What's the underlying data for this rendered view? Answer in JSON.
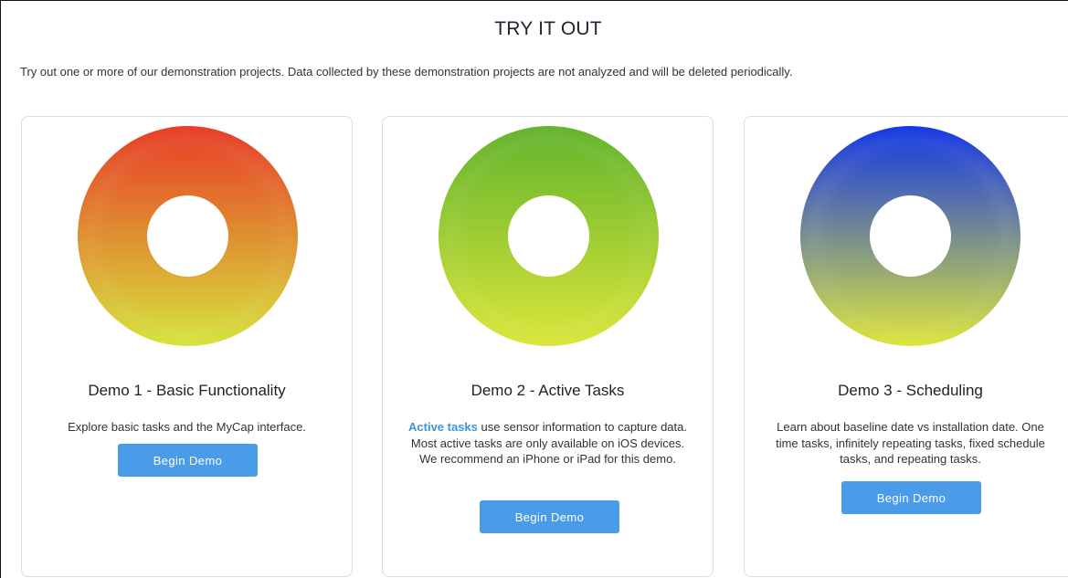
{
  "page": {
    "title": "TRY IT OUT",
    "intro": "Try out one or more of our demonstration projects. Data collected by these demonstration projects are not analyzed and will be deleted periodically."
  },
  "demos": [
    {
      "title": "Demo 1 - Basic Functionality",
      "description": "Explore basic tasks and the MyCap interface.",
      "button_label": "Begin Demo",
      "ring_colors": {
        "top": "#e83b26",
        "bottom": "#d6e33c"
      }
    },
    {
      "title": "Demo 2 - Active Tasks",
      "link_text": "Active tasks",
      "description": " use sensor information to capture data. Most active tasks are only available on iOS devices. We recommend an iPhone or iPad for this demo.",
      "button_label": "Begin Demo",
      "ring_colors": {
        "top": "#62b32c",
        "bottom": "#dbe63a"
      }
    },
    {
      "title": "Demo 3 - Scheduling",
      "description": "Learn about baseline date vs installation date. One time tasks, infinitely repeating tasks, fixed schedule tasks, and repeating tasks.",
      "button_label": "Begin Demo",
      "ring_colors": {
        "top": "#1236e6",
        "bottom": "#dde53a"
      }
    }
  ],
  "colors": {
    "accent": "#4a9be8",
    "link": "#3d95d9"
  }
}
